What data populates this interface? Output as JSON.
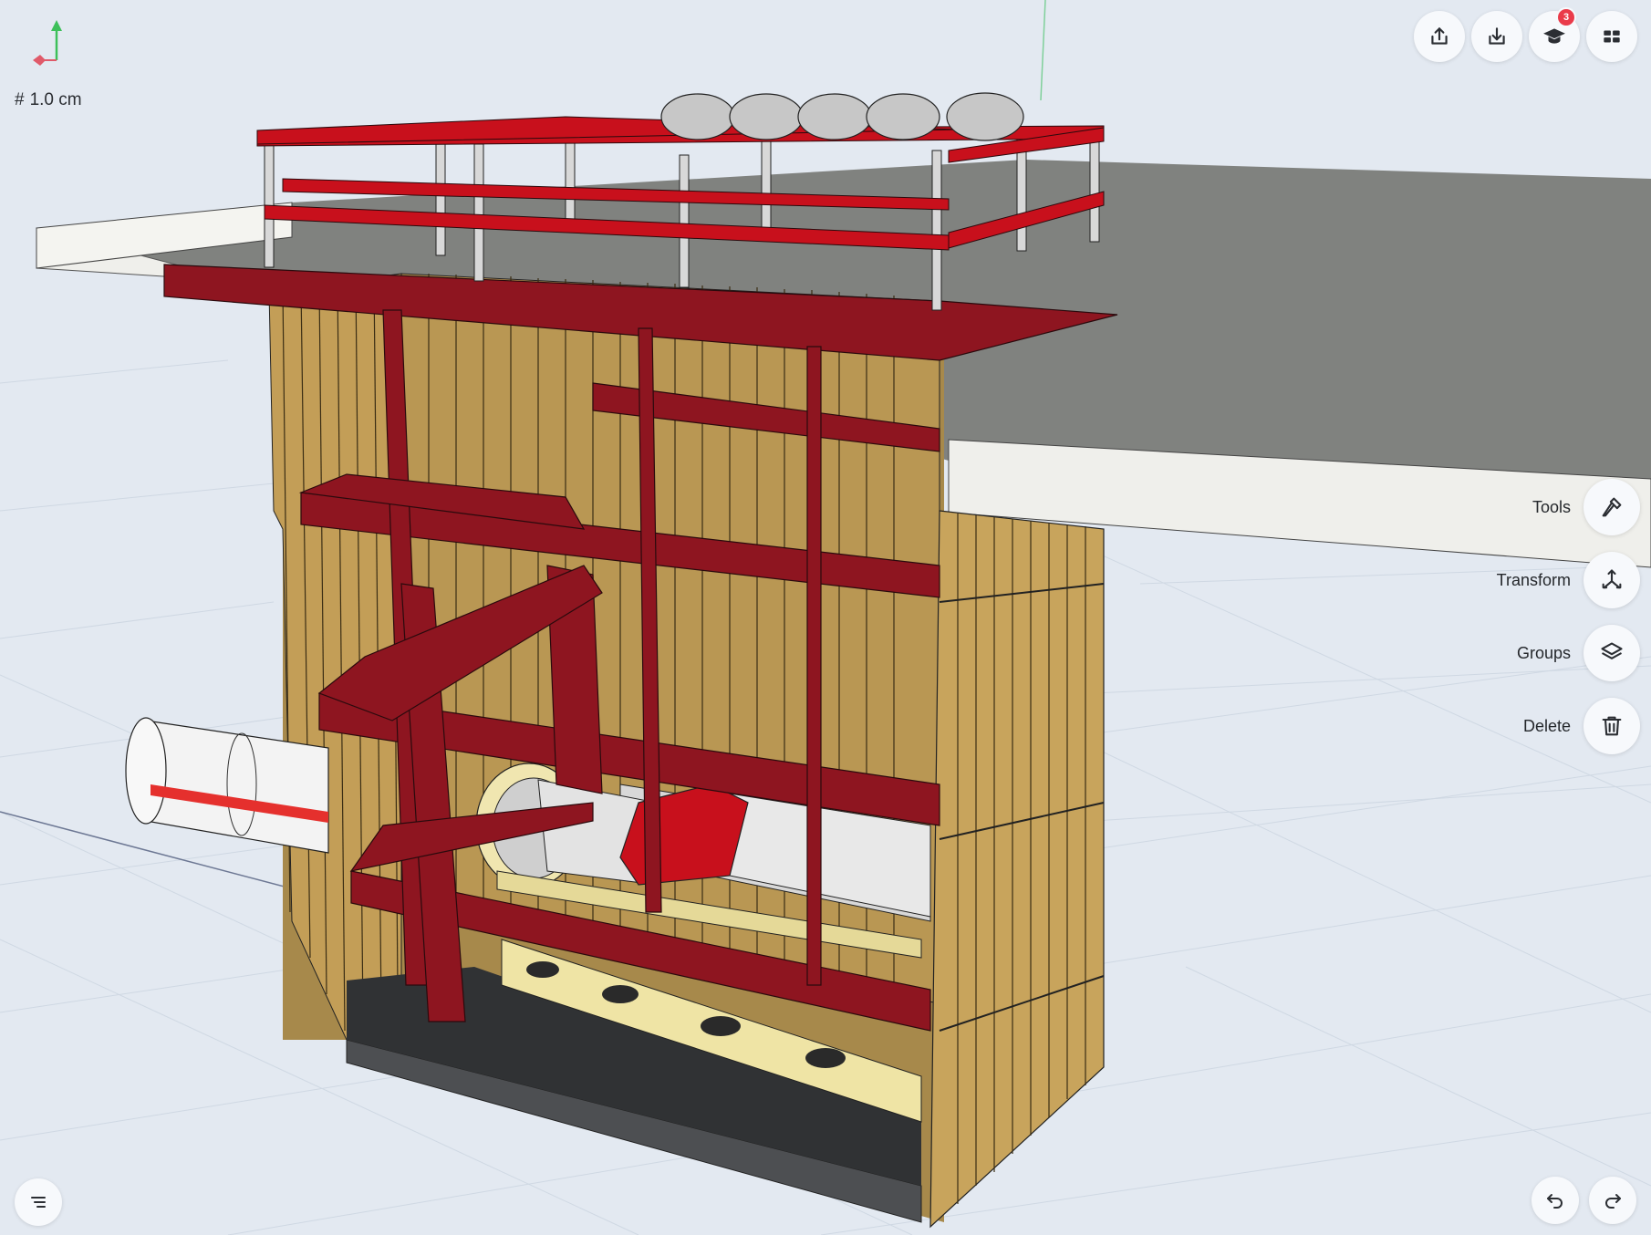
{
  "viewport": {
    "grid_size_label": "1.0 cm",
    "grid_hash": "#"
  },
  "toolbar": {
    "export_icon": "share-upload-icon",
    "import_icon": "download-icon",
    "learn_icon": "graduation-cap-icon",
    "learn_badge_count": "3",
    "grid_icon": "app-grid-icon"
  },
  "side_menu": {
    "items": [
      {
        "label": "Tools",
        "icon": "hammer-icon"
      },
      {
        "label": "Transform",
        "icon": "transform-axes-icon"
      },
      {
        "label": "Groups",
        "icon": "layers-icon"
      },
      {
        "label": "Delete",
        "icon": "trash-icon"
      }
    ]
  },
  "bottom": {
    "menu_icon": "menu-lines-icon",
    "undo_icon": "undo-icon",
    "redo_icon": "redo-icon"
  },
  "colors": {
    "background": "#e3e9f1",
    "frame_red": "#8e1520",
    "rail_red": "#c8101c",
    "timber": "#c6a25a",
    "slab_top": "#7e8184",
    "slab_side": "#efefeb",
    "badge_red": "#ea3b4a"
  }
}
